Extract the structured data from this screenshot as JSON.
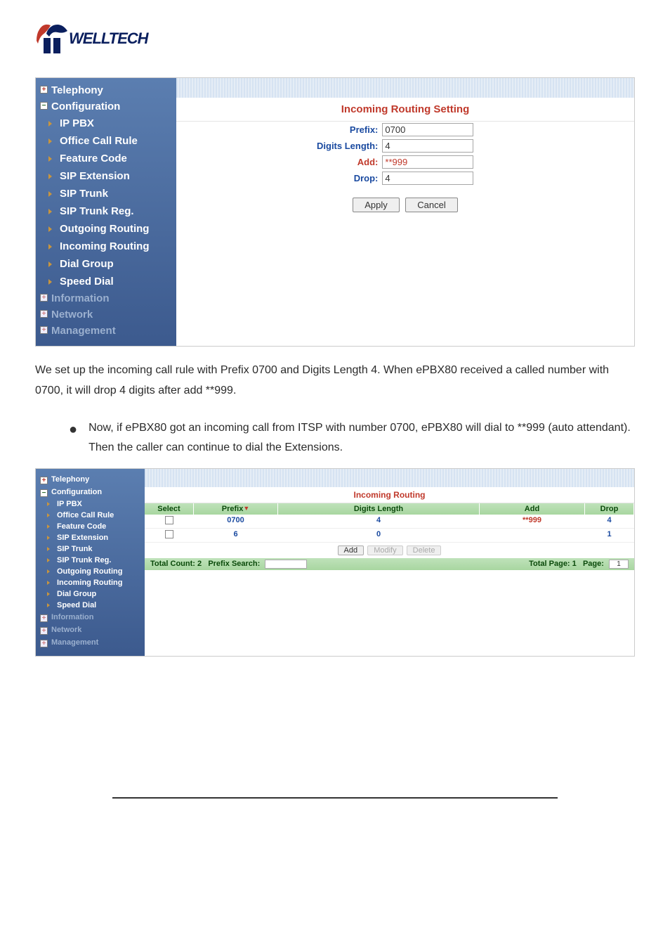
{
  "logo": {
    "text": "WELLTECH"
  },
  "screenshot1": {
    "panel_title": "Incoming Routing Setting",
    "sidebar": {
      "sections": [
        {
          "label": "Telephony",
          "icon": "+"
        },
        {
          "label": "Configuration",
          "icon": "−"
        },
        {
          "label": "Information",
          "icon": "+"
        },
        {
          "label": "Network",
          "icon": "+"
        },
        {
          "label": "Management",
          "icon": "+"
        }
      ],
      "items": [
        "IP PBX",
        "Office Call Rule",
        "Feature Code",
        "SIP Extension",
        "SIP Trunk",
        "SIP Trunk Reg.",
        "Outgoing Routing",
        "Incoming Routing",
        "Dial Group",
        "Speed Dial"
      ]
    },
    "form": {
      "prefix_label": "Prefix:",
      "prefix_value": "0700",
      "digits_label": "Digits Length:",
      "digits_value": "4",
      "add_label": "Add:",
      "add_value": "**999",
      "drop_label": "Drop:",
      "drop_value": "4"
    },
    "buttons": {
      "apply": "Apply",
      "cancel": "Cancel"
    }
  },
  "paragraph1": "We set up the incoming call rule with Prefix 0700 and Digits Length 4. When ePBX80 received a called number with 0700, it will drop 4 digits after add **999.",
  "bullet1": "Now, if ePBX80 got an incoming call from ITSP with number 0700, ePBX80 will dial to **999 (auto attendant). Then the caller can continue to dial the Extensions.",
  "screenshot2": {
    "panel_title": "Incoming Routing",
    "sidebar": {
      "sections": [
        {
          "label": "Telephony",
          "icon": "+"
        },
        {
          "label": "Configuration",
          "icon": "−"
        },
        {
          "label": "Information",
          "icon": "+"
        },
        {
          "label": "Network",
          "icon": "+"
        },
        {
          "label": "Management",
          "icon": "+"
        }
      ],
      "items": [
        "IP PBX",
        "Office Call Rule",
        "Feature Code",
        "SIP Extension",
        "SIP Trunk",
        "SIP Trunk Reg.",
        "Outgoing Routing",
        "Incoming Routing",
        "Dial Group",
        "Speed Dial"
      ]
    },
    "table": {
      "headers": {
        "select": "Select",
        "prefix": "Prefix",
        "sort": "▼",
        "digits": "Digits Length",
        "add": "Add",
        "drop": "Drop"
      },
      "rows": [
        {
          "prefix": "0700",
          "digits": "4",
          "add": "**999",
          "drop": "4"
        },
        {
          "prefix": "6",
          "digits": "0",
          "add": "",
          "drop": "1"
        }
      ]
    },
    "toolbar": {
      "add": "Add",
      "modify": "Modify",
      "delete": "Delete"
    },
    "footer": {
      "total_count_label": "Total Count:",
      "total_count": "2",
      "search_label": "Prefix Search:",
      "total_page_label": "Total Page:",
      "total_page": "1",
      "page_label": "Page:",
      "page": "1"
    }
  }
}
